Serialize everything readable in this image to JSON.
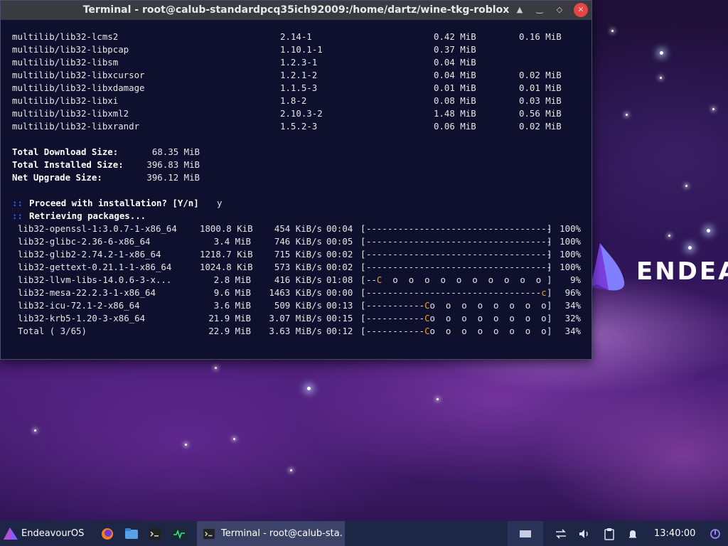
{
  "window": {
    "title": "Terminal - root@calub-standardpcq35ich92009:/home/dartz/wine-tkg-roblox"
  },
  "packages": [
    {
      "name": "multilib/lib32-lcms2",
      "version": "2.14-1",
      "size": "0.42 MiB",
      "download": "0.16 MiB"
    },
    {
      "name": "multilib/lib32-libpcap",
      "version": "1.10.1-1",
      "size": "0.37 MiB",
      "download": ""
    },
    {
      "name": "multilib/lib32-libsm",
      "version": "1.2.3-1",
      "size": "0.04 MiB",
      "download": ""
    },
    {
      "name": "multilib/lib32-libxcursor",
      "version": "1.2.1-2",
      "size": "0.04 MiB",
      "download": "0.02 MiB"
    },
    {
      "name": "multilib/lib32-libxdamage",
      "version": "1.1.5-3",
      "size": "0.01 MiB",
      "download": "0.01 MiB"
    },
    {
      "name": "multilib/lib32-libxi",
      "version": "1.8-2",
      "size": "0.08 MiB",
      "download": "0.03 MiB"
    },
    {
      "name": "multilib/lib32-libxml2",
      "version": "2.10.3-2",
      "size": "1.48 MiB",
      "download": "0.56 MiB"
    },
    {
      "name": "multilib/lib32-libxrandr",
      "version": "1.5.2-3",
      "size": "0.06 MiB",
      "download": "0.02 MiB"
    }
  ],
  "totals": [
    {
      "label": "Total Download Size:",
      "value": "68.35 MiB"
    },
    {
      "label": "Total Installed Size:",
      "value": "396.83 MiB"
    },
    {
      "label": "Net Upgrade Size:",
      "value": "396.12 MiB"
    }
  ],
  "prompts": {
    "arrow": "::",
    "proceed": "Proceed with installation? [Y/n]",
    "answer": "y",
    "retrieving": "Retrieving packages..."
  },
  "downloads": [
    {
      "name": "lib32-openssl-1:3.0.7-1-x86_64",
      "size": "1800.8 KiB",
      "rate": "454 KiB/s",
      "time": "00:04",
      "bar_open": "[",
      "bar": "-----------------------------------",
      "bar_accent": "",
      "bar_rest": "",
      "bar_close": "]",
      "percent": "100%"
    },
    {
      "name": "lib32-glibc-2.36-6-x86_64",
      "size": "3.4 MiB",
      "rate": "746 KiB/s",
      "time": "00:05",
      "bar_open": "[",
      "bar": "-----------------------------------",
      "bar_accent": "",
      "bar_rest": "",
      "bar_close": "]",
      "percent": "100%"
    },
    {
      "name": "lib32-glib2-2.74.2-1-x86_64",
      "size": "1218.7 KiB",
      "rate": "715 KiB/s",
      "time": "00:02",
      "bar_open": "[",
      "bar": "-----------------------------------",
      "bar_accent": "",
      "bar_rest": "",
      "bar_close": "]",
      "percent": "100%"
    },
    {
      "name": "lib32-gettext-0.21.1-1-x86_64",
      "size": "1024.8 KiB",
      "rate": "573 KiB/s",
      "time": "00:02",
      "bar_open": "[",
      "bar": "-----------------------------------",
      "bar_accent": "",
      "bar_rest": "",
      "bar_close": "]",
      "percent": "100%"
    },
    {
      "name": "lib32-llvm-libs-14.0.6-3-x...",
      "size": "2.8 MiB",
      "rate": "416 KiB/s",
      "time": "01:08",
      "bar_open": "[",
      "bar": "--",
      "bar_accent": "C",
      "bar_rest": "  o  o  o  o  o  o  o  o  o  o",
      "bar_close": "]",
      "percent": "9%"
    },
    {
      "name": "lib32-mesa-22.2.3-1-x86_64",
      "size": "9.6 MiB",
      "rate": "1463 KiB/s",
      "time": "00:00",
      "bar_open": "[",
      "bar": "---------------------------------",
      "bar_accent": "c",
      "bar_rest": "",
      "bar_close": "]",
      "percent": "96%"
    },
    {
      "name": "lib32-icu-72.1-2-x86_64",
      "size": "3.6 MiB",
      "rate": "509 KiB/s",
      "time": "00:13",
      "bar_open": "[",
      "bar": "-----------",
      "bar_accent": "C",
      "bar_rest": "o  o  o  o  o  o  o  o",
      "bar_close": "]",
      "percent": "34%"
    },
    {
      "name": "lib32-krb5-1.20-3-x86_64",
      "size": "21.9 MiB",
      "rate": "3.07 MiB/s",
      "time": "00:15",
      "bar_open": "[",
      "bar": "-----------",
      "bar_accent": "C",
      "bar_rest": "o  o  o  o  o  o  o  o",
      "bar_close": "]",
      "percent": "32%"
    },
    {
      "name": "Total ( 3/65)",
      "size": "22.9 MiB",
      "rate": "3.63 MiB/s",
      "time": "00:12",
      "bar_open": "[",
      "bar": "-----------",
      "bar_accent": "C",
      "bar_rest": "o  o  o  o  o  o  o  o",
      "bar_close": "]",
      "percent": "34%"
    }
  ],
  "desktop": {
    "logo_text": "ENDEAVOUR"
  },
  "taskbar": {
    "start_label": "EndeavourOS",
    "active_task": "Terminal - root@calub-sta...",
    "clock": "13:40:00",
    "icons": [
      "firefox-icon",
      "files-icon",
      "terminal-icon",
      "system-monitor-icon"
    ]
  },
  "colors": {
    "terminal_bg": "#0f0f2e",
    "titlebar": "#3a3b40",
    "close_button": "#e64545",
    "prompt_arrow": "#3a5cff",
    "progress_accent": "#ff9a1f",
    "taskbar": "#1e2645"
  }
}
